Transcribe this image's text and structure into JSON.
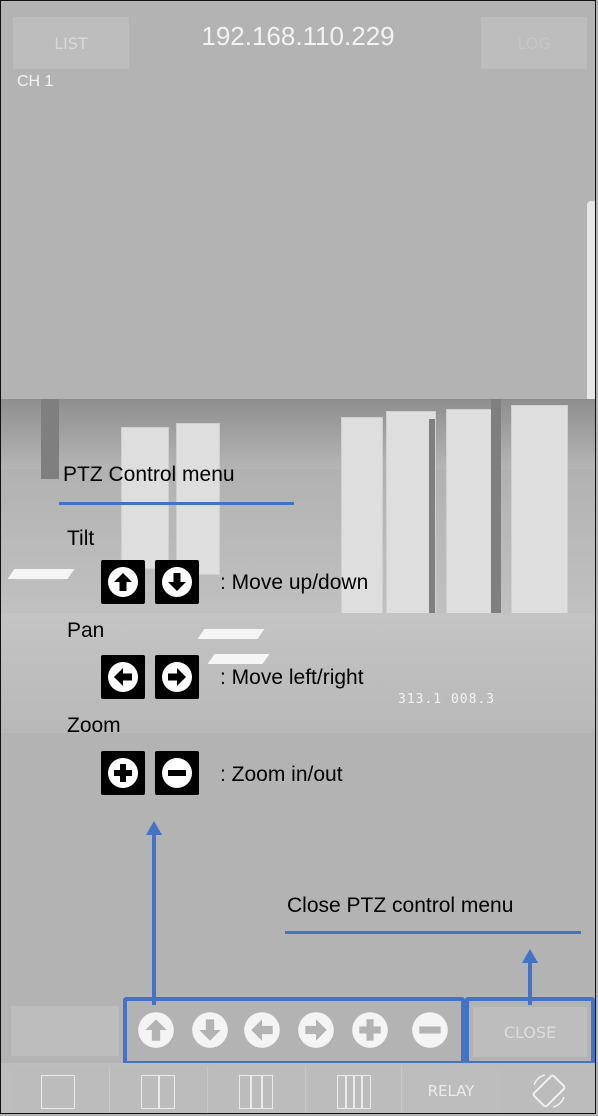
{
  "topbar": {
    "list_label": "LIST",
    "ip_address": "192.168.110.229",
    "log_label": "LOG"
  },
  "channel_label": "CH 1",
  "video": {
    "osd_text": "313.1 008.3"
  },
  "annotations": {
    "ptz_menu_title": "PTZ Control menu",
    "tilt_label": "Tilt",
    "tilt_desc": ": Move up/down",
    "pan_label": "Pan",
    "pan_desc": ": Move left/right",
    "zoom_label": "Zoom",
    "zoom_desc": ": Zoom in/out",
    "close_desc": "Close PTZ control menu",
    "accent_color": "#4472c4"
  },
  "ptz_bar": {
    "buttons": [
      "arrow-up",
      "arrow-down",
      "arrow-left",
      "arrow-right",
      "zoom-in",
      "zoom-out"
    ],
    "close_label": "CLOSE"
  },
  "bottombar": {
    "layouts": [
      "single",
      "split-2",
      "split-3",
      "split-4"
    ],
    "relay_label": "RELAY",
    "rotate_icon": "rotate-icon"
  }
}
